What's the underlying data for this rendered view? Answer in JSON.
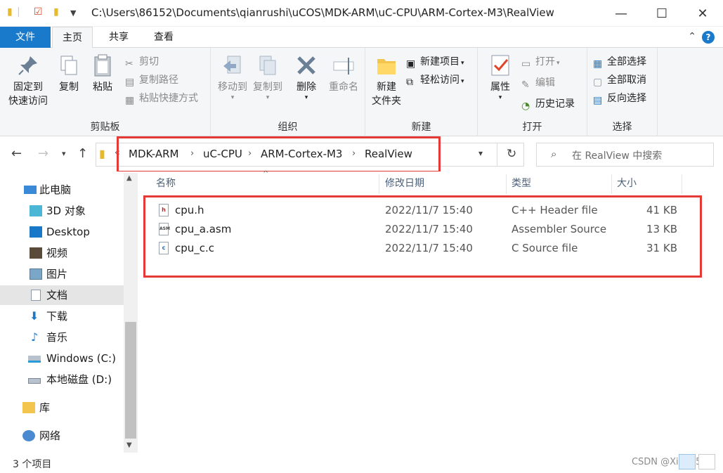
{
  "titlebar": {
    "path": "C:\\Users\\86152\\Documents\\qianrushi\\uCOS\\MDK-ARM\\uC-CPU\\ARM-Cortex-M3\\RealView",
    "minimize": "—",
    "maximize": "☐",
    "close": "✕"
  },
  "tabs": {
    "file": "文件",
    "home": "主页",
    "share": "共享",
    "view": "查看"
  },
  "ribbon": {
    "clipboard": {
      "label": "剪贴板",
      "pin_line1": "固定到",
      "pin_line2": "快速访问",
      "copy": "复制",
      "paste": "粘贴",
      "cut": "剪切",
      "copy_path": "复制路径",
      "paste_shortcut": "粘贴快捷方式"
    },
    "organize": {
      "label": "组织",
      "move_to": "移动到",
      "copy_to": "复制到",
      "delete": "删除",
      "rename": "重命名"
    },
    "new": {
      "label": "新建",
      "new_folder_line1": "新建",
      "new_folder_line2": "文件夹",
      "new_item": "新建项目",
      "easy_access": "轻松访问"
    },
    "open": {
      "label": "打开",
      "properties": "属性",
      "open": "打开",
      "edit": "编辑",
      "history": "历史记录"
    },
    "select": {
      "label": "选择",
      "select_all": "全部选择",
      "select_none": "全部取消",
      "invert": "反向选择"
    }
  },
  "address": {
    "crumbs": [
      "MDK-ARM",
      "uC-CPU",
      "ARM-Cortex-M3",
      "RealView"
    ],
    "search_placeholder": "在 RealView 中搜索"
  },
  "nav": {
    "items": [
      "此电脑",
      "3D 对象",
      "Desktop",
      "视频",
      "图片",
      "文档",
      "下载",
      "音乐",
      "Windows (C:)",
      "本地磁盘 (D:)",
      "库",
      "网络"
    ]
  },
  "columns": {
    "name": "名称",
    "date": "修改日期",
    "type": "类型",
    "size": "大小"
  },
  "files": [
    {
      "name": "cpu.h",
      "date": "2022/11/7 15:40",
      "type": "C++ Header file",
      "size": "41 KB",
      "icon": "header-file-icon"
    },
    {
      "name": "cpu_a.asm",
      "date": "2022/11/7 15:40",
      "type": "Assembler Source",
      "size": "13 KB",
      "icon": "asm-file-icon"
    },
    {
      "name": "cpu_c.c",
      "date": "2022/11/7 15:40",
      "type": "C Source file",
      "size": "31 KB",
      "icon": "c-file-icon"
    }
  ],
  "status": {
    "count": "3 个项目",
    "watermark": "CSDN @Xiumi543"
  },
  "colors": {
    "accent": "#1979ca",
    "highlight_box": "#e53935",
    "selected_nav": "#e5e5e5"
  }
}
